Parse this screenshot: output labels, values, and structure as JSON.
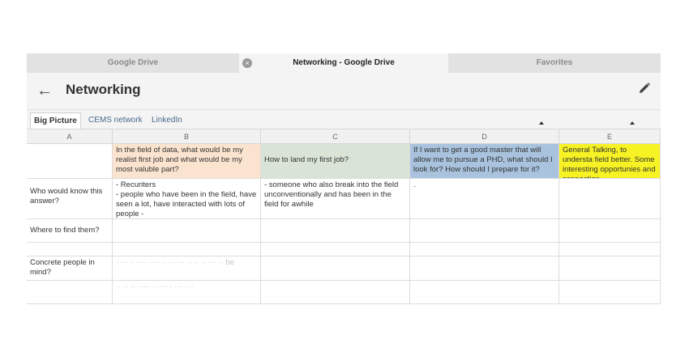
{
  "browser": {
    "tabs": [
      {
        "label": "Google Drive",
        "active": false
      },
      {
        "label": "Networking - Google Drive",
        "active": true
      },
      {
        "label": "Favorites",
        "active": false
      }
    ]
  },
  "header": {
    "title": "Networking"
  },
  "sheet_tabs": [
    "Big Picture",
    "CEMS network",
    "LinkedIn"
  ],
  "columns": [
    "A",
    "B",
    "C",
    "D",
    "E"
  ],
  "rows": {
    "r1": {
      "a": "",
      "b": "In the field of data, what would be my realist first job and what would be my most valuble part?",
      "c": "How to land my first job?",
      "d": "If I want to get a good master that will allow me to pursue a PHD, what should I look for? How should I prepare for it?",
      "e": "General Talking, to understa field better. Some interesting opportunies and connection"
    },
    "r2": {
      "a": "Who would know this answer?",
      "b": "- Recuriters\n- people who have been in the field, have seen a lot, have interacted with lots of people -",
      "c": "- someone who also break into the field unconventionally and has been in the field for awhile",
      "d": "."
    },
    "r3": {
      "a": "Where to find them?"
    },
    "r4": {
      "a": "Concrete people in mind?",
      "b_faded": "· ··· · ····· ···· ·  ··· ··· ·· ·· ·· ··· ·· be"
    },
    "r5": {
      "b_faded": "·· ·· ·· ····· · ···· · ··· · ··"
    }
  },
  "colors": {
    "peach": "#fbe4cf",
    "sage": "#d9e3d6",
    "blue": "#a9c3de",
    "yellow": "#f7f224"
  }
}
